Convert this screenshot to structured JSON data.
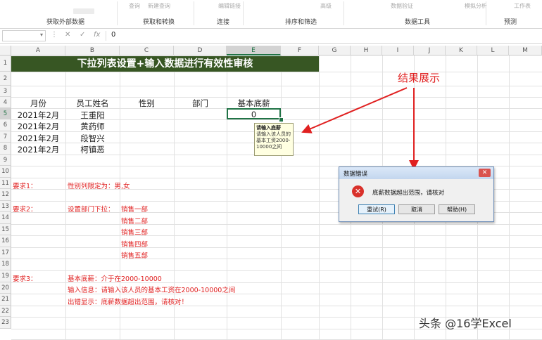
{
  "ribbon": {
    "groups": [
      "获取外部数据",
      "获取和转换",
      "连接",
      "排序和筛选",
      "数据工具",
      "预测"
    ],
    "faded_labels": [
      "查询",
      "新建查询",
      "编辑链接",
      "高级",
      "数据验证",
      "模拟分析",
      "工作表"
    ]
  },
  "formula_bar": {
    "name_box": "",
    "cancel_icon": "✕",
    "enter_icon": "✓",
    "fx_label": "fx",
    "value": "0"
  },
  "columns": [
    "A",
    "B",
    "C",
    "D",
    "E",
    "F",
    "G",
    "H",
    "I",
    "J",
    "K",
    "L",
    "M"
  ],
  "rows": [
    "1",
    "2",
    "3",
    "4",
    "5",
    "6",
    "7",
    "8",
    "9",
    "10",
    "11",
    "12",
    "13",
    "14",
    "15",
    "16",
    "17",
    "18",
    "19",
    "20",
    "21",
    "22",
    "23"
  ],
  "sheet": {
    "title": "下拉列表设置+输入数据进行有效性审核",
    "headers": {
      "month": "月份",
      "name": "员工姓名",
      "gender": "性别",
      "dept": "部门",
      "salary": "基本底薪"
    },
    "records": [
      {
        "month": "2021年2月",
        "name": "王重阳"
      },
      {
        "month": "2021年2月",
        "name": "黄药师"
      },
      {
        "month": "2021年2月",
        "name": "段智兴"
      },
      {
        "month": "2021年2月",
        "name": "柯镇恶"
      }
    ],
    "salary_value": "0",
    "req1_label": "要求1：",
    "req1_text": "性别列限定为：男,女",
    "req2_label": "要求2：",
    "req2_text": "设置部门下拉：",
    "departments": [
      "销售一部",
      "销售二部",
      "销售三部",
      "销售四部",
      "销售五部"
    ],
    "req3_label": "要求3：",
    "req3_lines": [
      "基本底薪：介于在2000-10000",
      "输入信息：请输入该人员的基本工资在2000-10000之间",
      "出错显示：底薪数据超出范围，请核对！"
    ]
  },
  "tooltip": {
    "title": "请输入底薪",
    "body": "请输入该人员的基本工资2000-10000之间"
  },
  "dialog": {
    "title": "数据错误",
    "close_icon": "✕",
    "message": "底薪数据超出范围，请核对",
    "retry": "重试(R)",
    "cancel": "取消",
    "help": "帮助(H)"
  },
  "annotation": {
    "result": "结果展示"
  },
  "watermark": "头条 @16学Excel",
  "colors": {
    "banner": "#375623",
    "accent": "#217346",
    "red": "#e02020"
  }
}
